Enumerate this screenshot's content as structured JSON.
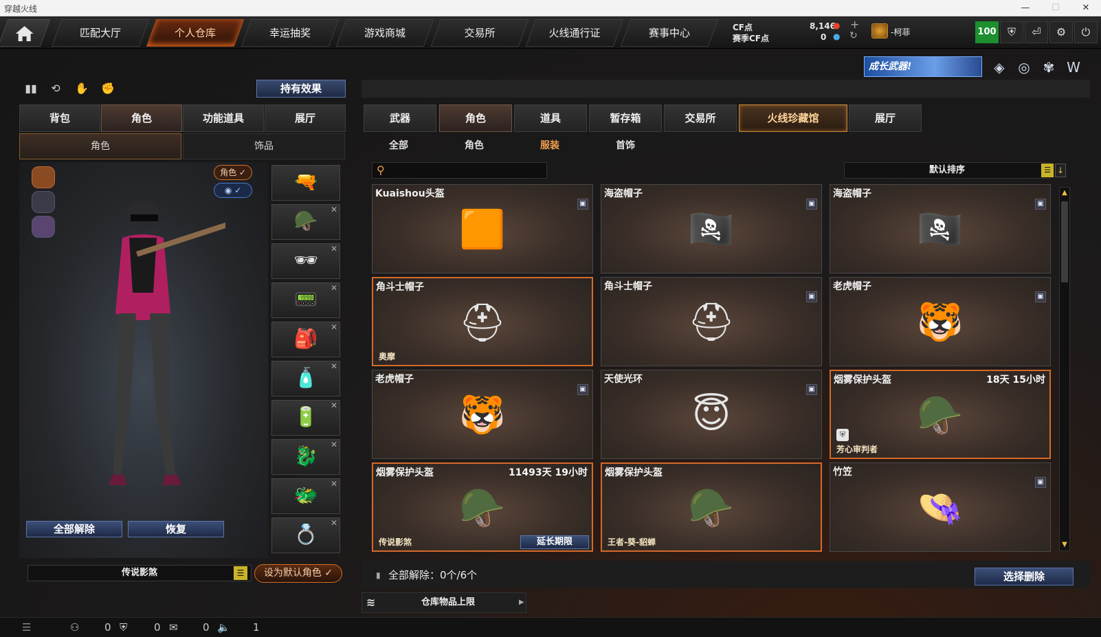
{
  "window": {
    "title": "穿越火线",
    "min": "—",
    "max": "☐",
    "close": "✕"
  },
  "nav": {
    "tabs": [
      "匹配大厅",
      "个人仓库",
      "幸运抽奖",
      "游戏商城",
      "交易所",
      "火线通行证",
      "赛事中心"
    ],
    "active_index": 1
  },
  "currency": {
    "cf_label": "CF点",
    "cf_value": "8,146",
    "season_label": "赛季CF点",
    "season_value": "0"
  },
  "user": {
    "name": "-柯菲",
    "level_score": "100"
  },
  "promo": {
    "text": "成长武器!"
  },
  "left": {
    "hold_effect": "持有效果",
    "tabs": [
      "背包",
      "角色",
      "功能道具",
      "展厅"
    ],
    "active_tab": 1,
    "subtabs": [
      "角色",
      "饰品"
    ],
    "active_subtab": 0,
    "pill_role": "角色 ✓",
    "pill_view": "◉ ✓",
    "release_all": "全部解除",
    "restore": "恢复",
    "preset_name": "传说影煞",
    "set_default": "设为默认角色 ✓"
  },
  "right": {
    "tabs": [
      "武器",
      "角色",
      "道具",
      "暂存箱",
      "交易所",
      "火线珍藏馆",
      "展厅"
    ],
    "active_tab": 1,
    "special_tab": 5,
    "subtabs": [
      "全部",
      "角色",
      "服装",
      "首饰"
    ],
    "active_subtab": 2,
    "search_placeholder": "",
    "sort_label": "默认排序",
    "bulk_text": "全部解除：0个/6个",
    "select_delete": "选择删除",
    "capacity": "仓库物品上限"
  },
  "items": [
    {
      "name": "Kuaishou头盔",
      "time": "",
      "sub": "",
      "icon": "🟧",
      "locked": true,
      "selected": false
    },
    {
      "name": "海盗帽子",
      "time": "",
      "sub": "",
      "icon": "🏴‍☠️",
      "locked": true,
      "selected": false
    },
    {
      "name": "海盗帽子",
      "time": "",
      "sub": "",
      "icon": "🏴‍☠️",
      "locked": true,
      "selected": false
    },
    {
      "name": "角斗士帽子",
      "time": "",
      "sub": "奥摩",
      "icon": "⛑",
      "locked": false,
      "selected": true
    },
    {
      "name": "角斗士帽子",
      "time": "",
      "sub": "",
      "icon": "⛑",
      "locked": true,
      "selected": false
    },
    {
      "name": "老虎帽子",
      "time": "",
      "sub": "",
      "icon": "🐯",
      "locked": true,
      "selected": false
    },
    {
      "name": "老虎帽子",
      "time": "",
      "sub": "",
      "icon": "🐯",
      "locked": true,
      "selected": false
    },
    {
      "name": "天使光环",
      "time": "",
      "sub": "",
      "icon": "😇",
      "locked": true,
      "selected": false
    },
    {
      "name": "烟雾保护头盔",
      "time": "18天 15小时",
      "sub": "芳心审判者",
      "icon": "🪖",
      "locked": false,
      "selected": true,
      "shield": true
    },
    {
      "name": "烟雾保护头盔",
      "time": "11493天 19小时",
      "sub": "传说影煞",
      "icon": "🪖",
      "locked": false,
      "selected": true,
      "extend": "延长期限"
    },
    {
      "name": "烟雾保护头盔",
      "time": "",
      "sub": "王者-葵-貂蝉",
      "icon": "🪖",
      "locked": false,
      "selected": true
    },
    {
      "name": "竹笠",
      "time": "",
      "sub": "",
      "icon": "👒",
      "locked": true,
      "selected": false
    }
  ],
  "status": {
    "count1": "0",
    "count2": "0",
    "count3": "0",
    "volume": "1"
  }
}
